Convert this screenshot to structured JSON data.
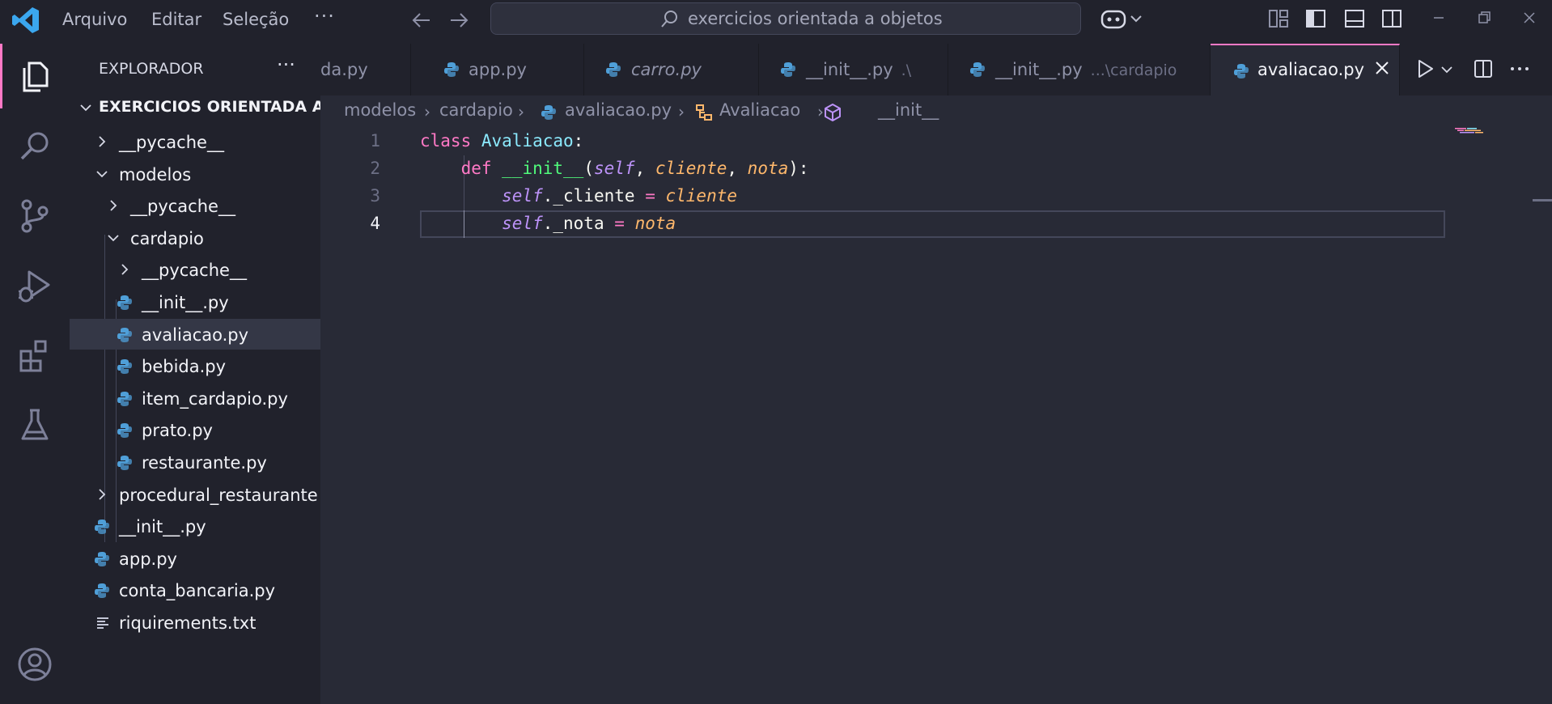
{
  "titlebar": {
    "menu": [
      "Arquivo",
      "Editar",
      "Seleção"
    ],
    "more": "···",
    "search": "exercicios orientada a objetos"
  },
  "activity_bar": {
    "items": [
      "explorer-icon",
      "search-icon",
      "source-control-icon",
      "run-debug-icon",
      "extensions-icon",
      "testing-icon"
    ],
    "bottom": "account-icon",
    "accent": "#ff79c6"
  },
  "sidebar": {
    "header": "EXPLORADOR",
    "more": "···",
    "root": "EXERCICIOS ORIENTADA A ...",
    "tree": [
      {
        "label": "__pycache__",
        "type": "folder",
        "expanded": false
      },
      {
        "label": "modelos",
        "type": "folder",
        "expanded": true
      },
      {
        "label": "__pycache__",
        "type": "folder",
        "expanded": false
      },
      {
        "label": "cardapio",
        "type": "folder",
        "expanded": true
      },
      {
        "label": "__pycache__",
        "type": "folder",
        "expanded": false
      },
      {
        "label": "__init__.py",
        "type": "python"
      },
      {
        "label": "avaliacao.py",
        "type": "python",
        "selected": true
      },
      {
        "label": "bebida.py",
        "type": "python"
      },
      {
        "label": "item_cardapio.py",
        "type": "python"
      },
      {
        "label": "prato.py",
        "type": "python"
      },
      {
        "label": "restaurante.py",
        "type": "python"
      },
      {
        "label": "procedural_restaurante",
        "type": "folder",
        "expanded": false
      },
      {
        "label": "__init__.py",
        "type": "python"
      },
      {
        "label": "app.py",
        "type": "python"
      },
      {
        "label": "conta_bancaria.py",
        "type": "python"
      },
      {
        "label": "riquirements.txt",
        "type": "text"
      }
    ]
  },
  "tabs": [
    {
      "label": "da.py",
      "desc": ""
    },
    {
      "label": "app.py",
      "desc": ""
    },
    {
      "label": "carro.py",
      "desc": ""
    },
    {
      "label": "__init__.py",
      "desc": ".\\"
    },
    {
      "label": "__init__.py",
      "desc": "...\\cardapio"
    },
    {
      "label": "avaliacao.py",
      "desc": "",
      "active": true
    }
  ],
  "breadcrumb": [
    "modelos",
    "cardapio",
    "avaliacao.py",
    "Avaliacao",
    "__init__"
  ],
  "editor": {
    "line_numbers": [
      "1",
      "2",
      "3",
      "4"
    ],
    "current_line": 4,
    "lines": [
      {
        "kw": "class",
        "name": "Avaliacao",
        "rest": ":"
      },
      {
        "kw": "def",
        "name": "__init__",
        "p0": "self",
        "p1": "cliente",
        "p2": "nota"
      },
      {
        "self": "self",
        "attr": "._cliente",
        "op": "=",
        "val": "cliente"
      },
      {
        "self": "self",
        "attr": "._nota",
        "op": "=",
        "val": "nota"
      }
    ]
  }
}
